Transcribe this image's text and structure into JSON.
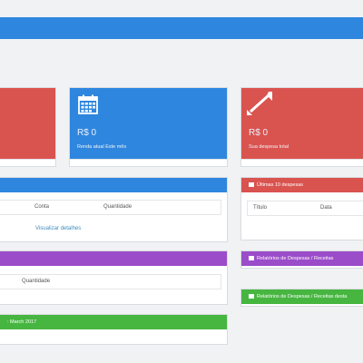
{
  "colors": {
    "blue": "#2e86de",
    "red": "#d9534f",
    "purple": "#9b4cc9",
    "green": "#46b640"
  },
  "stats": {
    "income": {
      "value": "R$ 0",
      "label": "Renda atual Este mês",
      "icon": "calendar-icon"
    },
    "expense": {
      "value": "R$ 0",
      "label": "Sua despesa total",
      "icon": "expand-arrows-icon"
    }
  },
  "panels": {
    "income_table": {
      "columns": [
        "Conta",
        "Quantidade"
      ],
      "link": "Visualizar detalhes"
    },
    "purple_table": {
      "columns": [
        "Quantidade"
      ]
    },
    "green_header": ": March 2017",
    "last_expenses": {
      "title": "Últimas 10 despesas",
      "columns": [
        "Título",
        "Data"
      ]
    },
    "report1": "Relatórios de Despesas / Receitas",
    "report2": "Relatórios de Despesas / Receitas desta"
  }
}
